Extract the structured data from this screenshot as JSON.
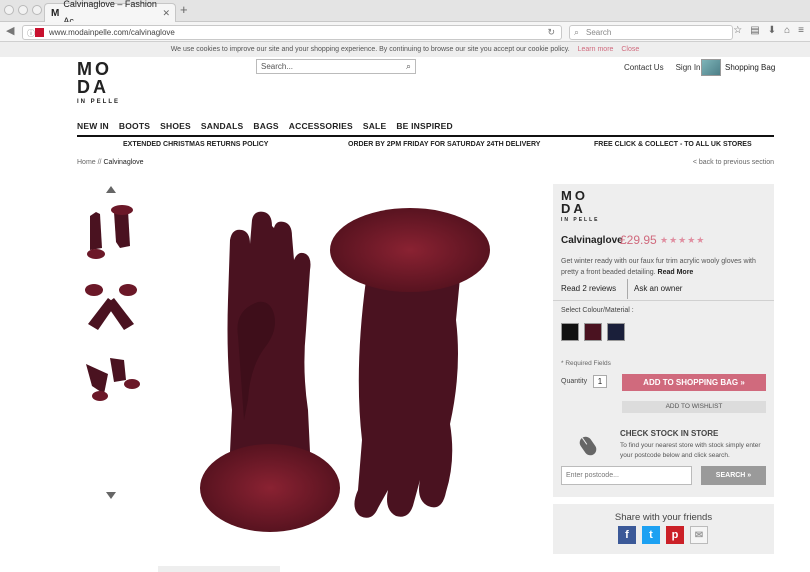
{
  "browser": {
    "tab_title": "Calvinaglove – Fashion Ac…",
    "url": "www.modainpelle.com/calvinaglove",
    "search_placeholder": "Search"
  },
  "cookie_bar": {
    "text": "We use cookies to improve our site and your shopping experience. By continuing to browse our site you accept our cookie policy.",
    "learn_more": "Learn more",
    "close": "Close"
  },
  "header": {
    "logo_line1": "MO",
    "logo_line2": "DA",
    "logo_line3": "IN PELLE",
    "search_placeholder": "Search...",
    "contact": "Contact Us",
    "signin": "Sign In",
    "bag": "Shopping Bag"
  },
  "nav": [
    "NEW IN",
    "BOOTS",
    "SHOES",
    "SANDALS",
    "BAGS",
    "ACCESSORIES",
    "SALE",
    "BE INSPIRED"
  ],
  "promo": {
    "left": "EXTENDED CHRISTMAS RETURNS POLICY",
    "center": "ORDER BY 2PM FRIDAY FOR SATURDAY 24TH DELIVERY",
    "right": "FREE CLICK & COLLECT - TO ALL UK STORES"
  },
  "breadcrumb": {
    "home": "Home //",
    "current": "Calvinaglove",
    "back": "< back to previous section"
  },
  "product": {
    "logo_a": "MO",
    "logo_b": "DA",
    "logo_c": "IN PELLE",
    "name": "Calvinaglove",
    "price": "£29.95",
    "stars": "★★★★★",
    "description": "Get winter ready with our faux fur trim acrylic wooly gloves with pretty a front beaded detailing.",
    "read_more": "Read More",
    "reviews": "Read 2 reviews",
    "ask_owner": "Ask an owner",
    "colour_label": "Select Colour/Material :",
    "swatches": [
      "#111111",
      "#4a1220",
      "#1a1f3a"
    ],
    "required": "* Required Fields",
    "qty_label": "Quantity",
    "qty_value": "1",
    "add_to_bag": "ADD TO SHOPPING BAG »",
    "wishlist": "ADD TO WISHLIST",
    "stock_title": "CHECK STOCK IN STORE",
    "stock_desc": "To find your nearest store with stock simply enter your postcode below and click search.",
    "postcode_placeholder": "Enter postcode...",
    "search_btn": "SEARCH »"
  },
  "share": {
    "title": "Share with your friends",
    "icons": [
      "facebook-icon",
      "twitter-icon",
      "pinterest-icon",
      "email-icon"
    ]
  }
}
